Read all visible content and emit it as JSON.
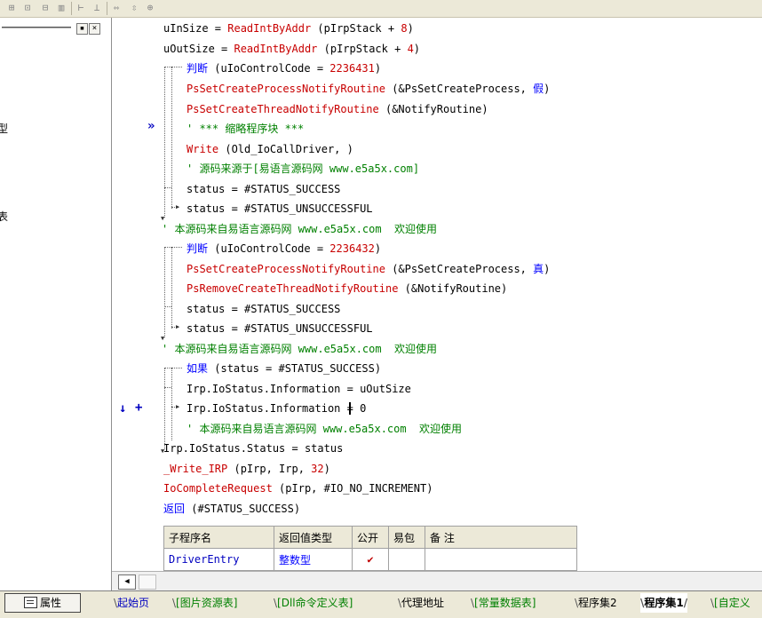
{
  "toolbar": {
    "icons": [
      "cell-merge-icon",
      "cell-split-icon",
      "row-insert-icon",
      "column-insert-icon",
      "align-width-icon",
      "align-height-icon",
      "same-width-icon",
      "same-height-icon",
      "same-size-icon"
    ]
  },
  "left_panel": {
    "fragment_1": "型",
    "fragment_2": "表"
  },
  "gutter": {
    "marker": "»",
    "arrow_down": "↓",
    "plus": "+"
  },
  "code": {
    "l1": {
      "a": "uInSize = ",
      "b": "ReadIntByAddr",
      "c": " (pIrpStack + ",
      "d": "8",
      "e": ")"
    },
    "l2": {
      "a": "uOutSize = ",
      "b": "ReadIntByAddr",
      "c": " (pIrpStack + ",
      "d": "4",
      "e": ")"
    },
    "l3": {
      "a": "判断",
      "b": " (uIoControlCode = ",
      "c": "2236431",
      "d": ")"
    },
    "l4": {
      "a": "PsSetCreateProcessNotifyRoutine",
      "b": " (&PsSetCreateProcess, ",
      "c": "假",
      "d": ")"
    },
    "l5": {
      "a": "PsSetCreateThreadNotifyRoutine",
      "b": " (&NotifyRoutine)"
    },
    "l6": {
      "a": "' *** 缩略程序块 ***"
    },
    "l7": {
      "a": "Write",
      "b": " (Old_IoCallDriver, )"
    },
    "l8": {
      "a": "' 源码来源于[易语言源码网 www.e5a5x.com]"
    },
    "l9": {
      "a": "status = #STATUS_SUCCESS"
    },
    "l10": {
      "a": "status = #STATUS_UNSUCCESSFUL"
    },
    "l11": {
      "a": "' 本源码来自易语言源码网 www.e5a5x.com  欢迎使用"
    },
    "l12": {
      "a": "判断",
      "b": " (uIoControlCode = ",
      "c": "2236432",
      "d": ")"
    },
    "l13": {
      "a": "PsSetCreateProcessNotifyRoutine",
      "b": " (&PsSetCreateProcess, ",
      "c": "真",
      "d": ")"
    },
    "l14": {
      "a": "PsRemoveCreateThreadNotifyRoutine",
      "b": " (&NotifyRoutine)"
    },
    "l15": {
      "a": "status = #STATUS_SUCCESS"
    },
    "l16": {
      "a": "status = #STATUS_UNSUCCESSFUL"
    },
    "l17": {
      "a": "' 本源码来自易语言源码网 www.e5a5x.com  欢迎使用"
    },
    "l18": {
      "a": "如果",
      "b": " (status = #STATUS_SUCCESS)"
    },
    "l19": {
      "a": "Irp.IoStatus.Information = uOutSize"
    },
    "l20": {
      "a": "Irp.IoStatus.Information ",
      "b": "= 0"
    },
    "l21": {
      "a": "' 本源码来自易语言源码网 www.e5a5x.com  欢迎使用"
    },
    "l22": {
      "a": "Irp.IoStatus.Status = status"
    },
    "l23": {
      "a": "_Write_IRP",
      "b": " (pIrp, Irp, ",
      "c": "32",
      "d": ")"
    },
    "l24": {
      "a": "IoCompleteRequest",
      "b": " (pIrp, #IO_NO_INCREMENT)"
    },
    "l25": {
      "a": "返回",
      "b": " (#STATUS_SUCCESS)"
    }
  },
  "sub_table": {
    "headers": [
      "子程序名",
      "返回值类型",
      "公开",
      "易包",
      "备 注"
    ],
    "row": {
      "name": "DriverEntry",
      "return_type": "整数型",
      "public_check": "✔",
      "package": "",
      "note": ""
    }
  },
  "scrollbar": {
    "left_arrow": "◀"
  },
  "tabs": {
    "properties": "属性",
    "items": [
      "起始页",
      "[图片资源表]",
      "[Dll命令定义表]",
      "代理地址",
      "[常量数据表]",
      "程序集2",
      "程序集1",
      "[自定义"
    ]
  },
  "colors": {
    "keyword": "#0000ff",
    "function": "#c80000",
    "comment": "#008000",
    "text": "#000000"
  }
}
